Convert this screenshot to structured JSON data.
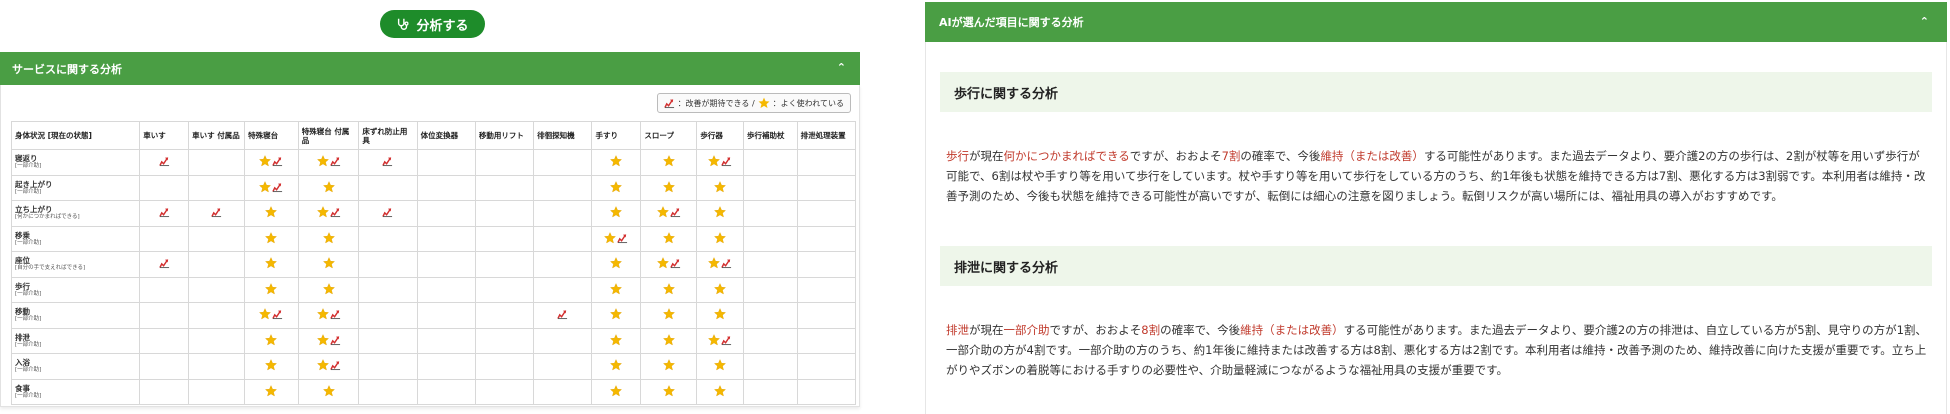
{
  "analyze_button": {
    "label": "分析する"
  },
  "service_panel": {
    "title": "サービスに関する分析",
    "legend": {
      "improve_label": "：改善が期待できる /",
      "used_label": "：よく使われている"
    },
    "columns": [
      "身体状況 [現在の状態]",
      "車いす",
      "車いす 付属品",
      "特殊寝台",
      "特殊寝台 付属品",
      "床ずれ防止用具",
      "体位変換器",
      "移動用リフト",
      "徘徊探知機",
      "手すり",
      "スロープ",
      "歩行器",
      "歩行補助杖",
      "排泄処理装置"
    ],
    "rows": [
      {
        "label": "寝返り",
        "status": "[一部介助]",
        "cells": [
          "A",
          "",
          "SA",
          "SA",
          "A",
          "",
          "",
          "",
          "S",
          "S",
          "SA",
          "",
          ""
        ]
      },
      {
        "label": "起き上がり",
        "status": "[一部介助]",
        "cells": [
          "",
          "",
          "SA",
          "S",
          "",
          "",
          "",
          "",
          "S",
          "S",
          "S",
          "",
          ""
        ]
      },
      {
        "label": "立ち上がり",
        "status": "[何かにつかまればできる]",
        "cells": [
          "A",
          "A",
          "S",
          "SA",
          "A",
          "",
          "",
          "",
          "S",
          "SA",
          "S",
          "",
          ""
        ]
      },
      {
        "label": "移乗",
        "status": "[一部介助]",
        "cells": [
          "",
          "",
          "S",
          "S",
          "",
          "",
          "",
          "",
          "SA",
          "S",
          "S",
          "",
          ""
        ]
      },
      {
        "label": "座位",
        "status": "[自分の手で支えればできる]",
        "cells": [
          "A",
          "",
          "S",
          "S",
          "",
          "",
          "",
          "",
          "S",
          "SA",
          "SA",
          "",
          ""
        ]
      },
      {
        "label": "歩行",
        "status": "[一部介助]",
        "cells": [
          "",
          "",
          "S",
          "S",
          "",
          "",
          "",
          "",
          "S",
          "S",
          "S",
          "",
          ""
        ]
      },
      {
        "label": "移動",
        "status": "[一部介助]",
        "cells": [
          "",
          "",
          "SA",
          "SA",
          "",
          "",
          "",
          "A",
          "S",
          "S",
          "S",
          "",
          ""
        ]
      },
      {
        "label": "排泄",
        "status": "[一部介助]",
        "cells": [
          "",
          "",
          "S",
          "SA",
          "",
          "",
          "",
          "",
          "S",
          "S",
          "SA",
          "",
          ""
        ]
      },
      {
        "label": "入浴",
        "status": "[一部介助]",
        "cells": [
          "",
          "",
          "S",
          "SA",
          "",
          "",
          "",
          "",
          "S",
          "S",
          "S",
          "",
          ""
        ]
      },
      {
        "label": "食事",
        "status": "[一部介助]",
        "cells": [
          "",
          "",
          "S",
          "S",
          "",
          "",
          "",
          "",
          "S",
          "S",
          "S",
          "",
          ""
        ]
      }
    ]
  },
  "ai_panel": {
    "title": "AIが選んだ項目に関する分析",
    "sections": [
      {
        "title": "歩行に関する分析",
        "parts": [
          {
            "t": "歩行",
            "hl": true
          },
          {
            "t": "が現在",
            "hl": false
          },
          {
            "t": "何かにつかまればできる",
            "hl": true
          },
          {
            "t": "ですが、おおよそ",
            "hl": false
          },
          {
            "t": "7割",
            "hl": true
          },
          {
            "t": "の確率で、今後",
            "hl": false
          },
          {
            "t": "維持（または改善）",
            "hl": true
          },
          {
            "t": "する可能性があります。また過去データより、要介護2の方の歩行は、2割が杖等を用いず歩行が可能で、6割は杖や手すり等を用いて歩行をしています。杖や手すり等を用いて歩行をしている方のうち、約1年後も状態を維持できる方は7割、悪化する方は3割弱です。本利用者は維持・改善予測のため、今後も状態を維持できる可能性が高いですが、転倒には細心の注意を図りましょう。転倒リスクが高い場所には、福祉用具の導入がおすすめです。",
            "hl": false
          }
        ]
      },
      {
        "title": "排泄に関する分析",
        "parts": [
          {
            "t": "排泄",
            "hl": true
          },
          {
            "t": "が現在",
            "hl": false
          },
          {
            "t": "一部介助",
            "hl": true
          },
          {
            "t": "ですが、おおよそ",
            "hl": false
          },
          {
            "t": "8割",
            "hl": true
          },
          {
            "t": "の確率で、今後",
            "hl": false
          },
          {
            "t": "維持（または改善）",
            "hl": true
          },
          {
            "t": "する可能性があります。また過去データより、要介護2の方の排泄は、自立している方が5割、見守りの方が1割、一部介助の方が4割です。一部介助の方のうち、約1年後に維持または改善する方は8割、悪化する方は2割です。本利用者は維持・改善予測のため、維持改善に向けた支援が重要です。立ち上がりやズボンの着脱等における手すりの必要性や、介助量軽減につながるような福祉用具の支援が重要です。",
            "hl": false
          }
        ]
      }
    ]
  },
  "colors": {
    "green_header": "#4a9e44",
    "button_green": "#1e8c2a",
    "highlight_red": "#c0392b",
    "section_bg": "#eef6ea"
  },
  "icons": {
    "star": "star-icon",
    "arrow": "improve-arrow-icon"
  }
}
